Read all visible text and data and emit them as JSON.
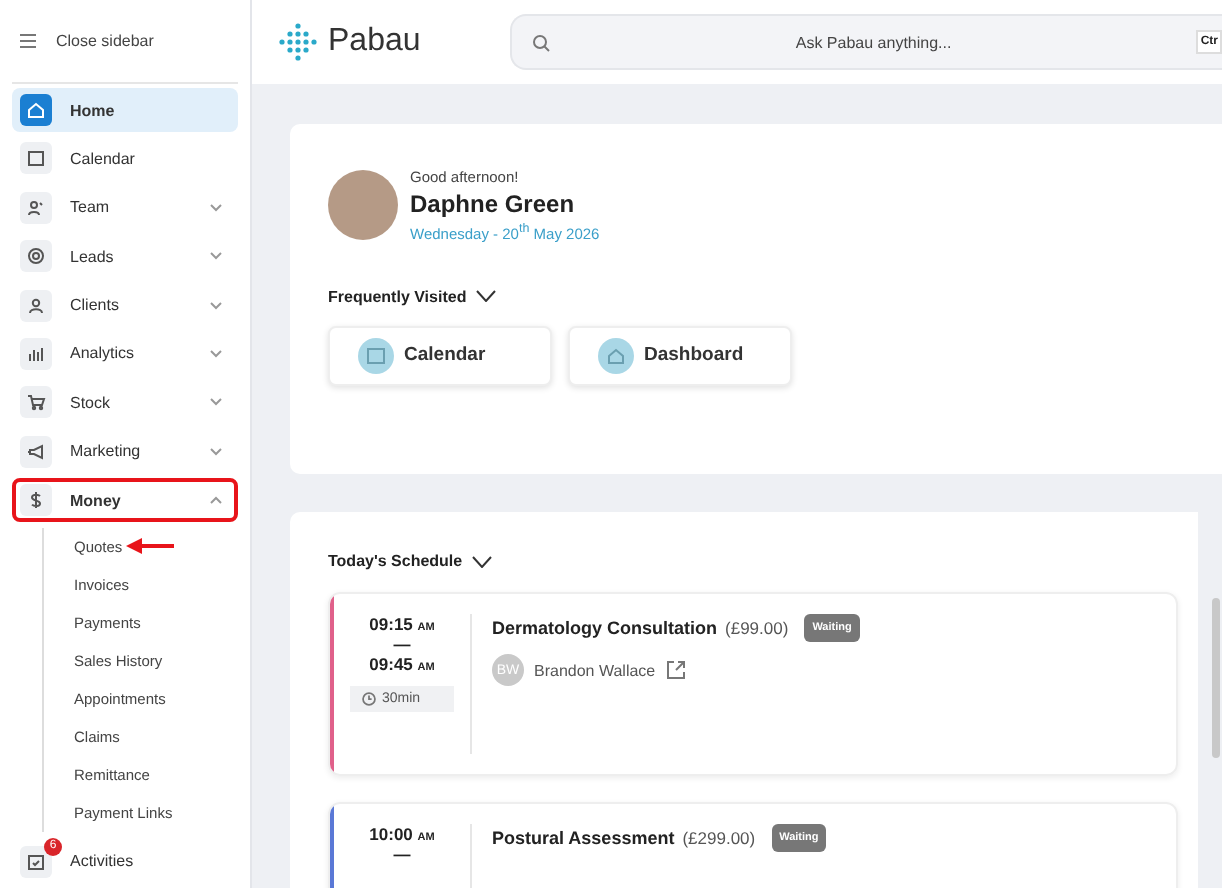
{
  "sidebar": {
    "close_label": "Close sidebar",
    "items": [
      {
        "label": "Home",
        "selected": true,
        "highlighted": false
      },
      {
        "label": "Calendar",
        "selected": false,
        "highlighted": false
      },
      {
        "label": "Team",
        "selected": false,
        "highlighted": false,
        "expanded": false
      },
      {
        "label": "Leads",
        "selected": false,
        "highlighted": false,
        "expanded": false
      },
      {
        "label": "Clients",
        "selected": false,
        "highlighted": false,
        "expanded": false
      },
      {
        "label": "Analytics",
        "selected": false,
        "highlighted": false,
        "expanded": false
      },
      {
        "label": "Stock",
        "selected": false,
        "highlighted": false,
        "expanded": false
      },
      {
        "label": "Marketing",
        "selected": false,
        "highlighted": false,
        "expanded": false
      },
      {
        "label": "Money",
        "selected": false,
        "highlighted": true,
        "expanded": true,
        "children": [
          {
            "label": "Quotes",
            "pointed": true
          },
          {
            "label": "Invoices",
            "pointed": false
          },
          {
            "label": "Payments",
            "pointed": false
          },
          {
            "label": "Sales History",
            "pointed": false
          },
          {
            "label": "Appointments",
            "pointed": false
          },
          {
            "label": "Claims",
            "pointed": false
          },
          {
            "label": "Remittance",
            "pointed": false
          },
          {
            "label": "Payment Links",
            "pointed": false
          }
        ]
      },
      {
        "label": "Activities",
        "selected": false,
        "highlighted": false,
        "badge": "6"
      }
    ]
  },
  "header": {
    "logo": "Pabau",
    "search": {
      "placeholder": "Ask Pabau anything...",
      "shortcut": "Ctr"
    }
  },
  "welcome": {
    "greeting": "Good afternoon!",
    "name": "Daphne Green",
    "date": "Wednesday - 20$^{th}$ May 2026",
    "frequent_title": "Frequently Visited",
    "frequent": [
      {
        "label": "Calendar"
      },
      {
        "label": "Dashboard"
      }
    ]
  },
  "schedule": {
    "title": "Today's Schedule",
    "appointments": [
      {
        "start": "09:15",
        "start_ampm": "AM",
        "dash": "—",
        "end": "09:45",
        "end_ampm": "AM",
        "duration": "30min",
        "title": "Dermatology Consultation",
        "price": "(£99.00)",
        "status": "Waiting",
        "initials": "BW",
        "client": "Brandon Wallace",
        "color": "#e0608a"
      },
      {
        "start": "10:00",
        "start_ampm": "AM",
        "dash": "—",
        "title": "Postural Assessment",
        "price": "(£299.00)",
        "status": "Waiting",
        "color": "#5a78d6"
      }
    ]
  }
}
